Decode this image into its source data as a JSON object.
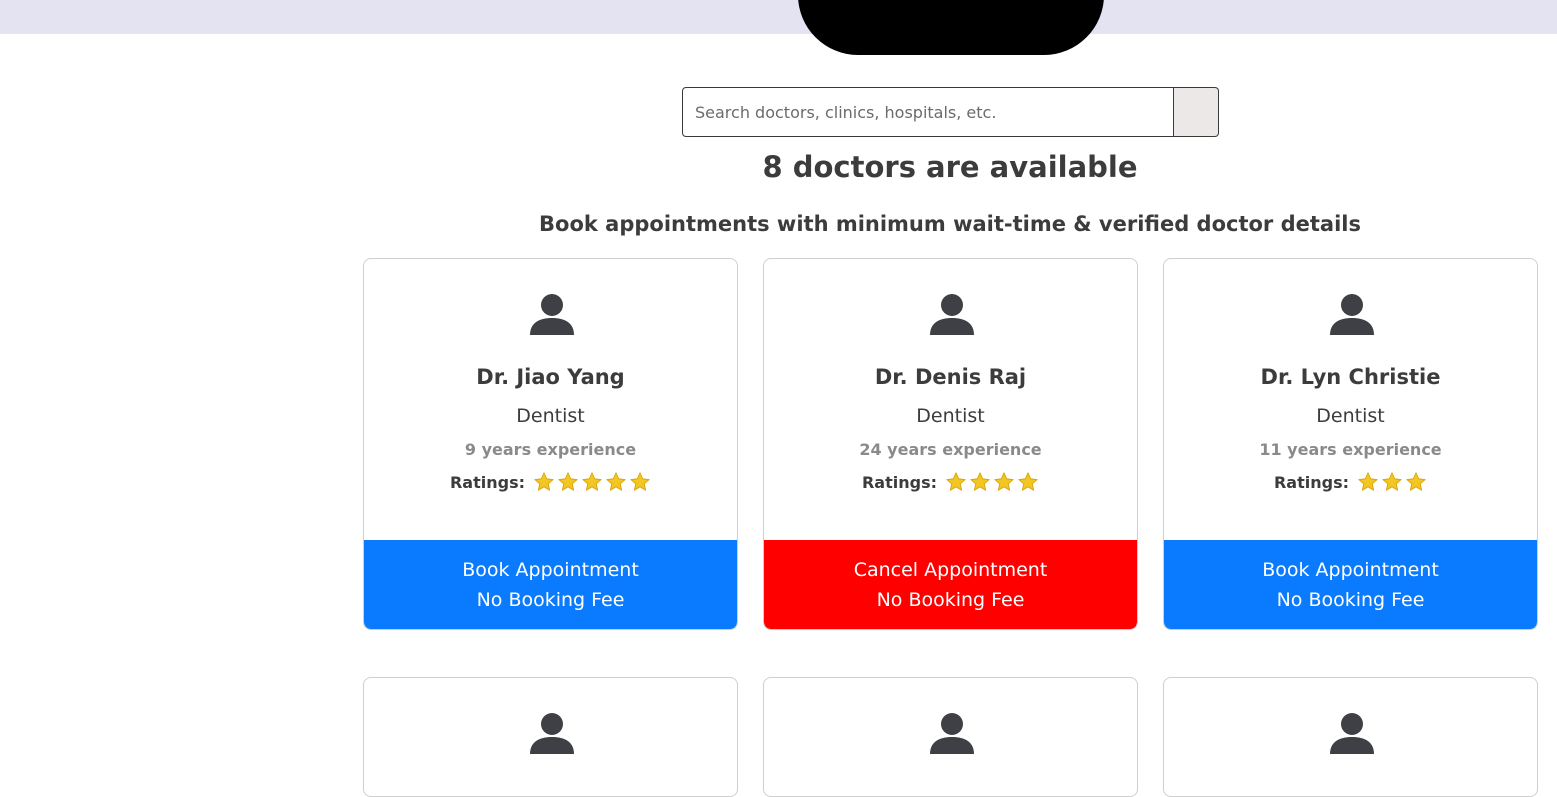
{
  "search": {
    "placeholder": "Search doctors, clinics, hospitals, etc."
  },
  "heading": {
    "count": "8 doctors are available",
    "subtitle": "Book appointments with minimum wait-time & verified doctor details"
  },
  "ratings_label": "Ratings:",
  "colors": {
    "book": "#0a7bff",
    "cancel": "#ff0000",
    "star": "#f3c623",
    "avatar": "#3f3f46"
  },
  "doctors": [
    {
      "name": "Dr. Jiao Yang",
      "specialty": "Dentist",
      "experience": "9 years experience",
      "rating": 5,
      "action": "Book Appointment",
      "fee": "No Booking Fee",
      "action_type": "book"
    },
    {
      "name": "Dr. Denis Raj",
      "specialty": "Dentist",
      "experience": "24 years experience",
      "rating": 4,
      "action": "Cancel Appointment",
      "fee": "No Booking Fee",
      "action_type": "cancel"
    },
    {
      "name": "Dr. Lyn Christie",
      "specialty": "Dentist",
      "experience": "11 years experience",
      "rating": 3,
      "action": "Book Appointment",
      "fee": "No Booking Fee",
      "action_type": "book"
    }
  ]
}
